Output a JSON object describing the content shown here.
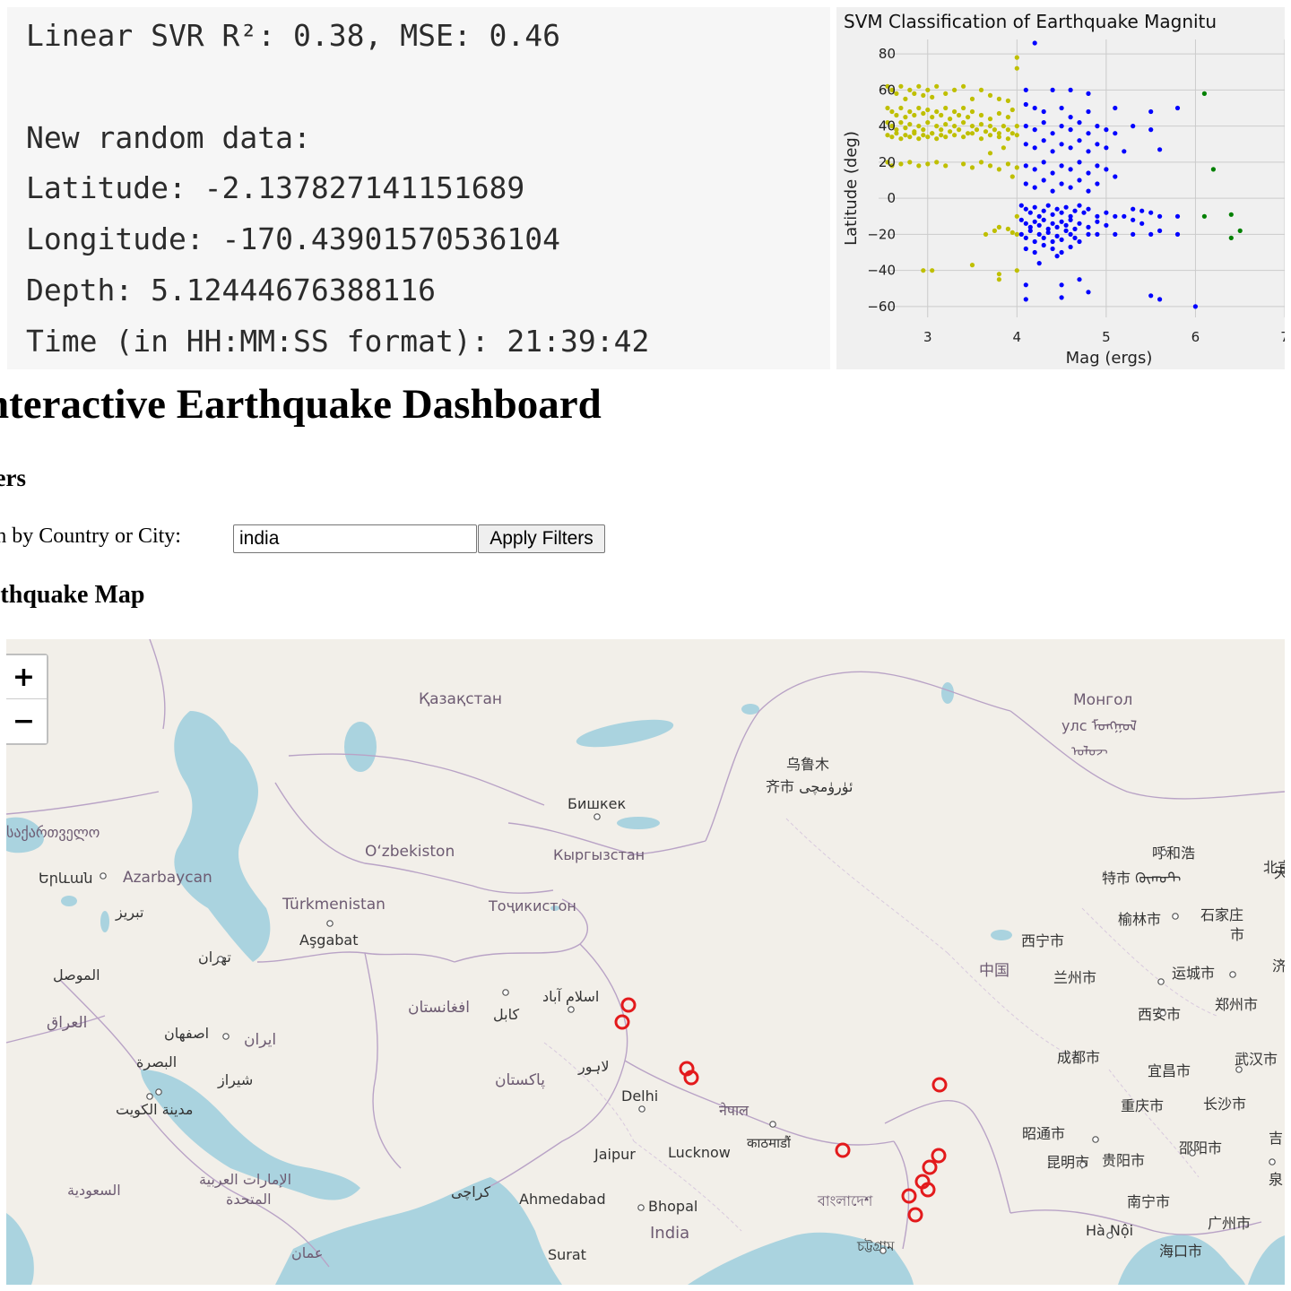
{
  "console": {
    "lines": [
      "Linear SVR R²: 0.38, MSE: 0.46",
      "",
      "New random data:",
      "Latitude: -2.137827141151689",
      "Longitude: -170.43901570536104",
      "Depth: 5.12444676388116",
      "Time (in HH:MM:SS format): 21:39:42"
    ]
  },
  "chart_data": {
    "type": "scatter",
    "title": "SVM Classification of Earthquake Magnitu",
    "xlabel": "Mag (ergs)",
    "ylabel": "Latitude (deg)",
    "xlim": [
      2.45,
      7.0
    ],
    "ylim": [
      -66,
      88
    ],
    "xticks": [
      "3",
      "4",
      "5",
      "6",
      "7"
    ],
    "yticks": [
      "80",
      "60",
      "40",
      "20",
      "0",
      "−20",
      "−40",
      "−60"
    ],
    "ytick_values": [
      80,
      60,
      40,
      20,
      0,
      -20,
      -40,
      -60
    ],
    "xtick_values": [
      3,
      4,
      5,
      6,
      7
    ],
    "grid": true,
    "colors": {
      "low": "#bfbf00",
      "mid": "#0000ff",
      "high": "#008000",
      "background": "#f0f0f0",
      "grid": "#cbcbcb"
    },
    "series": [
      {
        "color": "low",
        "points": [
          [
            2.55,
            62
          ],
          [
            2.6,
            60
          ],
          [
            2.65,
            58
          ],
          [
            2.7,
            62
          ],
          [
            2.75,
            55
          ],
          [
            2.8,
            60
          ],
          [
            2.85,
            58
          ],
          [
            2.9,
            62
          ],
          [
            2.95,
            57
          ],
          [
            3.0,
            60
          ],
          [
            3.05,
            56
          ],
          [
            3.1,
            62
          ],
          [
            3.2,
            58
          ],
          [
            3.3,
            60
          ],
          [
            3.4,
            62
          ],
          [
            3.5,
            55
          ],
          [
            3.6,
            60
          ],
          [
            3.7,
            57
          ],
          [
            3.8,
            55
          ],
          [
            3.9,
            54
          ],
          [
            2.55,
            50
          ],
          [
            2.6,
            48
          ],
          [
            2.65,
            46
          ],
          [
            2.7,
            50
          ],
          [
            2.75,
            45
          ],
          [
            2.8,
            48
          ],
          [
            2.85,
            46
          ],
          [
            2.9,
            50
          ],
          [
            2.95,
            47
          ],
          [
            3.0,
            49
          ],
          [
            3.05,
            45
          ],
          [
            3.1,
            48
          ],
          [
            3.15,
            46
          ],
          [
            3.2,
            50
          ],
          [
            3.25,
            44
          ],
          [
            3.3,
            48
          ],
          [
            3.35,
            46
          ],
          [
            3.4,
            50
          ],
          [
            3.45,
            45
          ],
          [
            3.5,
            48
          ],
          [
            3.6,
            46
          ],
          [
            3.7,
            44
          ],
          [
            3.8,
            47
          ],
          [
            3.9,
            45
          ],
          [
            3.95,
            49
          ],
          [
            2.55,
            42
          ],
          [
            2.6,
            40
          ],
          [
            2.65,
            38
          ],
          [
            2.7,
            42
          ],
          [
            2.75,
            39
          ],
          [
            2.8,
            41
          ],
          [
            2.85,
            37
          ],
          [
            2.9,
            40
          ],
          [
            2.95,
            38
          ],
          [
            3.0,
            42
          ],
          [
            3.05,
            36
          ],
          [
            3.1,
            40
          ],
          [
            3.15,
            38
          ],
          [
            3.2,
            41
          ],
          [
            3.25,
            37
          ],
          [
            3.3,
            40
          ],
          [
            3.35,
            38
          ],
          [
            3.4,
            42
          ],
          [
            3.45,
            36
          ],
          [
            3.5,
            40
          ],
          [
            3.55,
            38
          ],
          [
            3.6,
            41
          ],
          [
            3.65,
            37
          ],
          [
            3.7,
            40
          ],
          [
            3.75,
            38
          ],
          [
            3.8,
            36
          ],
          [
            3.85,
            40
          ],
          [
            3.9,
            38
          ],
          [
            3.95,
            36
          ],
          [
            4.0,
            40
          ],
          [
            2.55,
            35
          ],
          [
            2.6,
            34
          ],
          [
            2.65,
            36
          ],
          [
            2.7,
            33
          ],
          [
            2.75,
            35
          ],
          [
            2.8,
            34
          ],
          [
            2.85,
            36
          ],
          [
            2.9,
            33
          ],
          [
            2.95,
            35
          ],
          [
            3.0,
            34
          ],
          [
            3.05,
            36
          ],
          [
            3.1,
            33
          ],
          [
            3.15,
            35
          ],
          [
            3.2,
            34
          ],
          [
            3.3,
            35
          ],
          [
            3.4,
            34
          ],
          [
            3.5,
            36
          ],
          [
            3.6,
            33
          ],
          [
            3.7,
            35
          ],
          [
            3.8,
            34
          ],
          [
            3.9,
            33
          ],
          [
            4.0,
            35
          ],
          [
            2.55,
            20
          ],
          [
            2.6,
            18
          ],
          [
            2.7,
            19
          ],
          [
            2.8,
            20
          ],
          [
            2.9,
            18
          ],
          [
            3.0,
            19
          ],
          [
            3.1,
            20
          ],
          [
            3.2,
            18
          ],
          [
            3.4,
            19
          ],
          [
            3.5,
            17
          ],
          [
            3.6,
            20
          ],
          [
            3.7,
            18
          ],
          [
            3.8,
            16
          ],
          [
            3.9,
            19
          ],
          [
            4.0,
            17
          ],
          [
            3.7,
            25
          ],
          [
            3.85,
            28
          ],
          [
            3.95,
            12
          ],
          [
            4.0,
            -10
          ],
          [
            3.8,
            -16
          ],
          [
            3.9,
            -17
          ],
          [
            4.0,
            -20
          ],
          [
            3.75,
            -18
          ],
          [
            3.95,
            -19
          ],
          [
            2.95,
            -40
          ],
          [
            3.05,
            -40
          ],
          [
            3.5,
            -37
          ],
          [
            3.8,
            -42
          ],
          [
            3.8,
            -45
          ],
          [
            4.0,
            -40
          ],
          [
            3.65,
            -20
          ],
          [
            4.0,
            78
          ],
          [
            4.0,
            72
          ]
        ]
      },
      {
        "color": "mid",
        "points": [
          [
            4.2,
            86
          ],
          [
            4.1,
            60
          ],
          [
            4.4,
            60
          ],
          [
            4.6,
            60
          ],
          [
            4.8,
            58
          ],
          [
            4.1,
            52
          ],
          [
            4.2,
            50
          ],
          [
            4.3,
            48
          ],
          [
            4.5,
            50
          ],
          [
            4.6,
            45
          ],
          [
            4.8,
            48
          ],
          [
            5.1,
            50
          ],
          [
            5.5,
            48
          ],
          [
            5.8,
            50
          ],
          [
            4.1,
            40
          ],
          [
            4.2,
            38
          ],
          [
            4.3,
            42
          ],
          [
            4.4,
            36
          ],
          [
            4.5,
            40
          ],
          [
            4.6,
            38
          ],
          [
            4.7,
            42
          ],
          [
            4.8,
            36
          ],
          [
            4.9,
            40
          ],
          [
            5.0,
            38
          ],
          [
            5.1,
            36
          ],
          [
            5.3,
            40
          ],
          [
            5.5,
            38
          ],
          [
            4.1,
            30
          ],
          [
            4.2,
            28
          ],
          [
            4.3,
            32
          ],
          [
            4.4,
            26
          ],
          [
            4.5,
            30
          ],
          [
            4.6,
            28
          ],
          [
            4.7,
            32
          ],
          [
            4.8,
            26
          ],
          [
            4.9,
            30
          ],
          [
            5.0,
            28
          ],
          [
            5.2,
            26
          ],
          [
            5.6,
            27
          ],
          [
            4.1,
            18
          ],
          [
            4.2,
            16
          ],
          [
            4.3,
            20
          ],
          [
            4.4,
            14
          ],
          [
            4.5,
            18
          ],
          [
            4.6,
            16
          ],
          [
            4.7,
            20
          ],
          [
            4.8,
            14
          ],
          [
            4.9,
            18
          ],
          [
            5.0,
            16
          ],
          [
            5.1,
            12
          ],
          [
            4.1,
            8
          ],
          [
            4.2,
            6
          ],
          [
            4.3,
            10
          ],
          [
            4.4,
            4
          ],
          [
            4.5,
            8
          ],
          [
            4.6,
            6
          ],
          [
            4.7,
            10
          ],
          [
            4.8,
            4
          ],
          [
            4.9,
            8
          ],
          [
            4.05,
            -4
          ],
          [
            4.1,
            -6
          ],
          [
            4.15,
            -8
          ],
          [
            4.2,
            -5
          ],
          [
            4.25,
            -10
          ],
          [
            4.3,
            -7
          ],
          [
            4.35,
            -4
          ],
          [
            4.4,
            -9
          ],
          [
            4.45,
            -6
          ],
          [
            4.5,
            -8
          ],
          [
            4.55,
            -5
          ],
          [
            4.6,
            -10
          ],
          [
            4.65,
            -7
          ],
          [
            4.7,
            -4
          ],
          [
            4.75,
            -8
          ],
          [
            4.8,
            -6
          ],
          [
            4.9,
            -10
          ],
          [
            5.0,
            -8
          ],
          [
            5.3,
            -6
          ],
          [
            5.5,
            -8
          ],
          [
            4.05,
            -12
          ],
          [
            4.1,
            -14
          ],
          [
            4.15,
            -16
          ],
          [
            4.2,
            -13
          ],
          [
            4.25,
            -15
          ],
          [
            4.3,
            -12
          ],
          [
            4.35,
            -17
          ],
          [
            4.4,
            -14
          ],
          [
            4.45,
            -16
          ],
          [
            4.5,
            -13
          ],
          [
            4.55,
            -15
          ],
          [
            4.6,
            -12
          ],
          [
            4.65,
            -17
          ],
          [
            4.7,
            -14
          ],
          [
            4.8,
            -16
          ],
          [
            4.9,
            -13
          ],
          [
            5.0,
            -15
          ],
          [
            5.1,
            -10
          ],
          [
            5.2,
            -10
          ],
          [
            5.3,
            -12
          ],
          [
            5.4,
            -14
          ],
          [
            5.6,
            -10
          ],
          [
            5.8,
            -10
          ],
          [
            4.05,
            -20
          ],
          [
            4.1,
            -22
          ],
          [
            4.15,
            -18
          ],
          [
            4.2,
            -24
          ],
          [
            4.25,
            -20
          ],
          [
            4.3,
            -22
          ],
          [
            4.35,
            -19
          ],
          [
            4.4,
            -24
          ],
          [
            4.45,
            -21
          ],
          [
            4.5,
            -23
          ],
          [
            4.55,
            -18
          ],
          [
            4.6,
            -20
          ],
          [
            4.65,
            -22
          ],
          [
            4.7,
            -24
          ],
          [
            4.8,
            -20
          ],
          [
            4.9,
            -20
          ],
          [
            5.1,
            -20
          ],
          [
            5.3,
            -20
          ],
          [
            5.5,
            -20
          ],
          [
            5.6,
            -18
          ],
          [
            5.8,
            -20
          ],
          [
            4.1,
            -28
          ],
          [
            4.2,
            -30
          ],
          [
            4.3,
            -26
          ],
          [
            4.4,
            -28
          ],
          [
            4.5,
            -30
          ],
          [
            4.6,
            -27
          ],
          [
            4.25,
            -36
          ],
          [
            4.45,
            -32
          ],
          [
            4.1,
            -48
          ],
          [
            4.5,
            -48
          ],
          [
            4.5,
            -55
          ],
          [
            4.7,
            -45
          ],
          [
            4.8,
            -52
          ],
          [
            4.1,
            -56
          ],
          [
            5.5,
            -54
          ],
          [
            5.6,
            -56
          ],
          [
            6.0,
            -60
          ],
          [
            5.4,
            -7
          ]
        ]
      },
      {
        "color": "high",
        "points": [
          [
            6.1,
            58
          ],
          [
            6.2,
            16
          ],
          [
            6.1,
            -10
          ],
          [
            6.4,
            -9
          ],
          [
            6.5,
            -18
          ],
          [
            6.4,
            -22
          ]
        ]
      }
    ]
  },
  "dashboard": {
    "title": "nteractive Earthquake Dashboard",
    "filters_heading": "lters",
    "search_label": "arch by Country or City:",
    "search_value": "india",
    "apply_label": "Apply Filters",
    "map_heading": "arthquake Map"
  },
  "map": {
    "zoom_in": "+",
    "zoom_out": "−",
    "marker_color": "#e31a1c",
    "water_color": "#aad3df",
    "land_color": "#f2efe9",
    "country_labels": [
      "Қазақстан",
      "Монгол",
      "улс ᠮᠣᠩᠭᠣᠯ",
      "ᠤᠯᠤᠵ",
      "საქართველო",
      "Azarbaycan",
      "Oʻzbekiston",
      "Кыргызстан",
      "Türkmenistan",
      "Тоҷикистон",
      "افغانستان",
      "ایران",
      "العراق",
      "پاکستان",
      "नेपाल",
      "中国",
      "বাংলাদেশ",
      "India",
      "السعودية",
      "الإمارات العربية",
      "المتحدة",
      "عمان"
    ],
    "city_labels": [
      "乌鲁木",
      "齐市 ئۈرۈمچى",
      "Бишкек",
      "Երևան",
      "تبریز",
      "Aşgabat",
      "تهران",
      "الموصل",
      "اصفهان",
      "البصرة",
      "شیراز",
      "مدينة الكويت",
      "كابل",
      "اسلام آباد",
      "لاہور",
      "Delhi",
      "Jaipur",
      "Lucknow",
      "काठमाडौं",
      "كراچی",
      "Ahmedabad",
      "Bhopal",
      "Surat",
      "চট্টগ্রাম",
      "西宁市",
      "兰州市",
      "成都市",
      "重庆市",
      "昆明市",
      "贵阳市",
      "昭通市",
      "呼和浩",
      "特市 ᠬᠥᠬᠣᠲ",
      "榆林市",
      "石家庄",
      "市",
      "北京",
      "运城市",
      "郑州市",
      "西安市",
      "宜昌市",
      "武汉市",
      "长沙市",
      "邵阳市",
      "南宁市",
      "Hà Nội",
      "广州市",
      "海口市",
      "吉",
      "泉",
      "天",
      "济"
    ]
  }
}
